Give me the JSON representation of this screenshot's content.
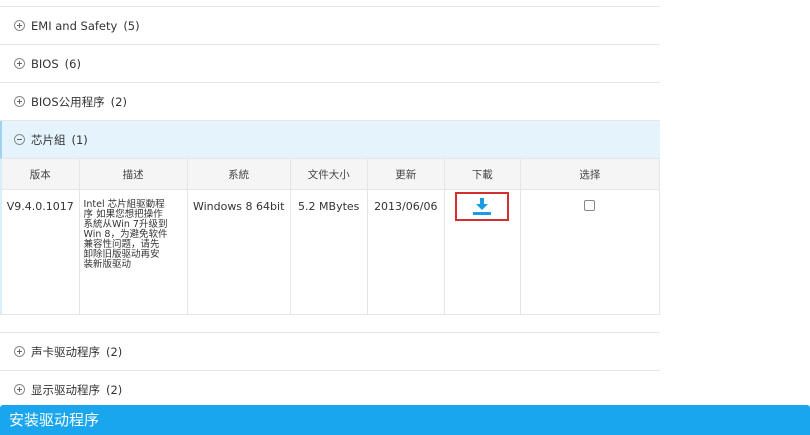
{
  "categories_top": [
    {
      "name": "EMI and Safety",
      "count": "(5)"
    },
    {
      "name": "BIOS",
      "count": "(6)"
    },
    {
      "name": "BIOS公用程序",
      "count": "(2)"
    }
  ],
  "open_category": {
    "name": "芯片組",
    "count": "(1)"
  },
  "table": {
    "headers": [
      "版本",
      "描述",
      "系統",
      "文件大小",
      "更新",
      "下載",
      "选择"
    ],
    "row": {
      "version": "V9.4.0.1017",
      "description": "Intel 芯片組驱動程序 如果您想把操作系統从Win 7升级到Win 8，为避免软件兼容性问题，请先卸除旧版驱动再安装新版驱动",
      "os": "Windows 8 64bit",
      "size": "5.2 MBytes",
      "date": "2013/06/06"
    }
  },
  "categories_bottom": [
    {
      "name": "声卡驱动程序",
      "count": "(2)"
    },
    {
      "name": "显示驱动程序",
      "count": "(2)"
    }
  ],
  "install_bar": {
    "title": "安装驱动程序"
  },
  "colors": {
    "accent": "#1aa6ee",
    "download_icon": "#1a9be3",
    "highlight_border": "#d32f2f"
  }
}
